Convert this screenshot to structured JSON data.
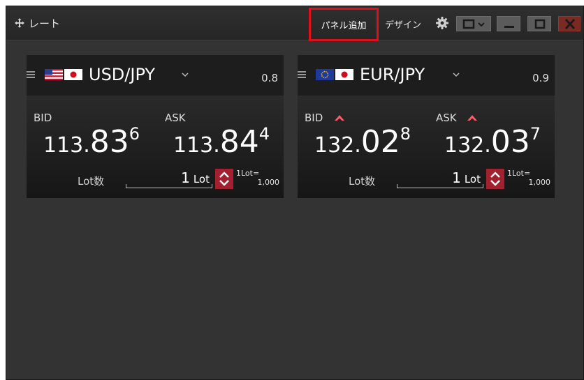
{
  "window": {
    "title": "レート",
    "add_panel_label": "パネル追加",
    "design_label": "デザイン"
  },
  "panels": [
    {
      "pair": "USD/JPY",
      "spread": "0.8",
      "bid": {
        "label": "BID",
        "p1": "113.",
        "p2": "83",
        "p3": "6"
      },
      "ask": {
        "label": "ASK",
        "p1": "113.",
        "p2": "84",
        "p3": "4"
      },
      "lot_label": "Lot数",
      "lot_value": "1",
      "lot_unit": "Lot",
      "lot_note_a": "1Lot=",
      "lot_note_b": "1,000"
    },
    {
      "pair": "EUR/JPY",
      "spread": "0.9",
      "bid": {
        "label": "BID",
        "p1": "132.",
        "p2": "02",
        "p3": "8"
      },
      "ask": {
        "label": "ASK",
        "p1": "132.",
        "p2": "03",
        "p3": "7"
      },
      "lot_label": "Lot数",
      "lot_value": "1",
      "lot_unit": "Lot",
      "lot_note_a": "1Lot=",
      "lot_note_b": "1,000"
    }
  ],
  "icons": {
    "move": "move-icon",
    "gear": "gear-icon",
    "menu": "hamburger-icon",
    "chevron": "chevron-down-icon",
    "uptick": "up-arrow-icon",
    "stepper": "up-down-stepper-icon"
  },
  "colors": {
    "window_bg": "#333333",
    "highlight": "#e0101a",
    "stepper": "#a3202e",
    "uptick": "#ff5a6a"
  }
}
